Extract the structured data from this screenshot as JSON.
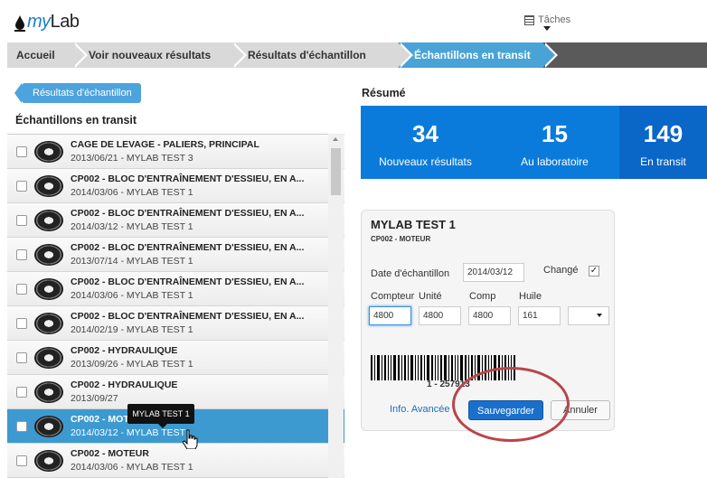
{
  "header": {
    "brand_prefix": "",
    "brand_em": "my",
    "brand_suffix": "Lab",
    "tasks_label": "Tâches"
  },
  "breadcrumb": [
    {
      "label": "Accueil"
    },
    {
      "label": "Voir nouveaux résultats"
    },
    {
      "label": "Résultats d'échantillon"
    },
    {
      "label": "Échantillons en transit"
    }
  ],
  "left": {
    "back_label": "Résultats d'échantillon",
    "title": "Échantillons en transit",
    "rows": [
      {
        "title": "CAGE DE LEVAGE - PALIERS, PRINCIPAL",
        "sub": "2013/06/21 - MYLAB TEST 3"
      },
      {
        "title": "CP002 - BLOC D'ENTRAÎNEMENT D'ESSIEU, EN A...",
        "sub": "2014/03/06 - MYLAB TEST 1"
      },
      {
        "title": "CP002 - BLOC D'ENTRAÎNEMENT D'ESSIEU, EN A...",
        "sub": "2014/03/12 - MYLAB TEST 1"
      },
      {
        "title": "CP002 - BLOC D'ENTRAÎNEMENT D'ESSIEU, EN A...",
        "sub": "2013/07/14 - MYLAB TEST 1"
      },
      {
        "title": "CP002 - BLOC D'ENTRAÎNEMENT D'ESSIEU, EN A...",
        "sub": "2014/03/06 - MYLAB TEST 1"
      },
      {
        "title": "CP002 - BLOC D'ENTRAÎNEMENT D'ESSIEU, EN A...",
        "sub": "2014/02/19 - MYLAB TEST 1"
      },
      {
        "title": "CP002 - HYDRAULIQUE",
        "sub": "2013/09/26 - MYLAB TEST 1"
      },
      {
        "title": "CP002 - HYDRAULIQUE",
        "sub": "2013/09/27"
      },
      {
        "title": "CP002 - MOT",
        "sub": "2014/03/12 - MYLAB TEST"
      },
      {
        "title": "CP002 - MOTEUR",
        "sub": "2014/03/06 - MYLAB TEST 1"
      }
    ],
    "tooltip": "MYLAB TEST 1"
  },
  "summary": {
    "title": "Résumé",
    "stats": [
      {
        "value": "34",
        "label": "Nouveaux résultats"
      },
      {
        "value": "15",
        "label": "Au laboratoire"
      },
      {
        "value": "149",
        "label": "En transit"
      }
    ]
  },
  "card": {
    "title": "MYLAB TEST 1",
    "subtitle": "CP002 - MOTEUR",
    "date_label": "Date d'échantillon",
    "date_value": "2014/03/12",
    "changed_label": "Changé",
    "changed_checked": true,
    "col_compteur": "Compteur",
    "col_unite": "Unité",
    "col_comp": "Comp",
    "col_huile": "Huile",
    "compteur_value": "4800",
    "unite_value": "4800",
    "comp_value": "4800",
    "huile_value": "161",
    "select_value": "",
    "barcode_number": "1 - 257913",
    "info_link": "Info. Avancée",
    "save_label": "Sauvegarder",
    "cancel_label": "Annuler"
  },
  "colors": {
    "accent": "#0b7bdb",
    "active_crumb": "#4aa3d6",
    "selected_row": "#3d9ad1",
    "highlight": "#b8454a"
  }
}
